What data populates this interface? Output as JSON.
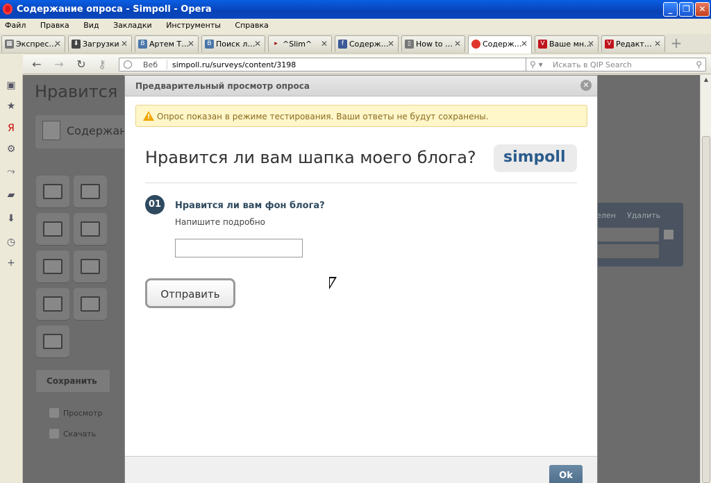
{
  "window": {
    "title": "Содержание опроса - Simpoll - Opera"
  },
  "menu": [
    "Файл",
    "Правка",
    "Вид",
    "Закладки",
    "Инструменты",
    "Справка"
  ],
  "tabs": [
    {
      "label": "Экспрес…",
      "icon": "speed-dial-icon"
    },
    {
      "label": "Загрузки",
      "icon": "download-icon"
    },
    {
      "label": "Артем Т…",
      "icon": "vk-icon"
    },
    {
      "label": "Поиск л…",
      "icon": "vk-icon"
    },
    {
      "label": "^Slim^",
      "icon": "arrow-icon"
    },
    {
      "label": "Содерж…",
      "icon": "facebook-icon"
    },
    {
      "label": "How to …",
      "icon": "page-icon"
    },
    {
      "label": "Содерж…",
      "icon": "simpoll-icon"
    },
    {
      "label": "Ваше мн…",
      "icon": "simpoll-icon"
    },
    {
      "label": "Редакт…",
      "icon": "simpoll-icon"
    }
  ],
  "address": {
    "scheme_label": "Веб",
    "url": "simpoll.ru/surveys/content/3198",
    "search_placeholder": "Искать в QIP Search"
  },
  "background_page": {
    "title": "Нравится",
    "tab_label": "Содержан",
    "save_label": "Сохранить",
    "preview_link": "Просмотр",
    "download_link": "Скачать",
    "rename_label": "елен",
    "delete_label": "Удалить"
  },
  "modal": {
    "header": "Предварительный просмотр опроса",
    "warning": "Опрос показан в режиме тестирования. Ваши ответы не будут сохранены.",
    "survey_title": "Нравится ли вам шапка моего блога?",
    "brand": "simpoll",
    "question": {
      "number": "01",
      "text": "Нравится ли вам фон блога?",
      "hint": "Напишите подробно",
      "value": ""
    },
    "submit_label": "Отправить",
    "ok_label": "Ok"
  },
  "colors": {
    "titlebar": "#0842b6",
    "warning_bg": "#fff6c9",
    "question_number_bg": "#2f4a5f",
    "ok_button": "#4b6b88"
  }
}
